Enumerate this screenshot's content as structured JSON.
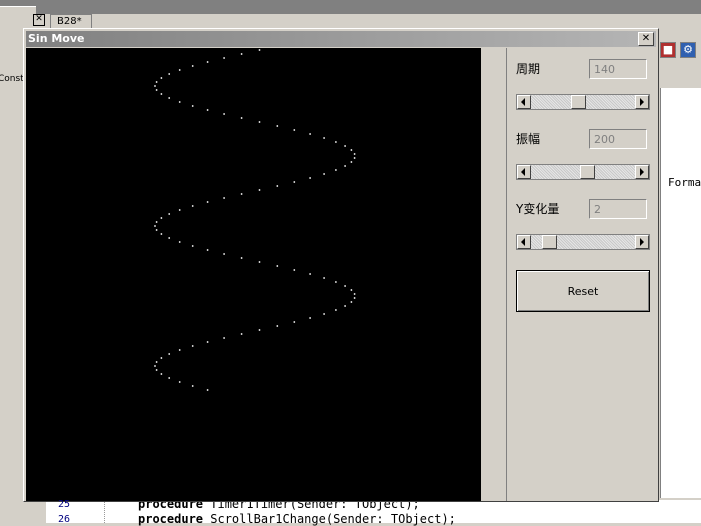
{
  "ide": {
    "tab_label": "B28*",
    "left_panel_text": "Const",
    "close_glyph": "✕",
    "right_panel_text": "Forma",
    "code_lines": [
      {
        "number": "25",
        "keyword": "procedure",
        "rest": " Timer1Timer(Sender: TObject);"
      },
      {
        "number": "26",
        "keyword": "procedure",
        "rest": " ScrollBar1Change(Sender: TObject);"
      }
    ]
  },
  "window": {
    "title": "Sin Move",
    "close_glyph": "✕"
  },
  "controls": {
    "period": {
      "label": "周期",
      "value": "140",
      "slider_fraction": 0.45
    },
    "amplitude": {
      "label": "振幅",
      "value": "200",
      "slider_fraction": 0.55
    },
    "y_change": {
      "label": "Y变化量",
      "value": "2",
      "slider_fraction": 0.12
    },
    "reset_label": "Reset"
  },
  "wave": {
    "color": "#ffffff",
    "background": "#000000",
    "period": 140,
    "amplitude": 200
  },
  "colors": {
    "window_bg": "#d4d0c8",
    "titlebar": "#808080",
    "canvas": "#000000"
  }
}
